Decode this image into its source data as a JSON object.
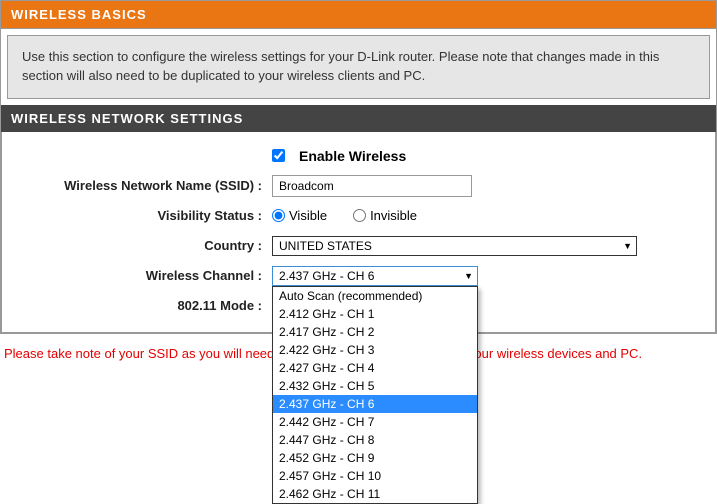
{
  "basics": {
    "title": "WIRELESS BASICS",
    "info": "Use this section to configure the wireless settings for your D-Link router. Please note that changes made in this section will also need to be duplicated to your wireless clients and PC."
  },
  "settings": {
    "title": "WIRELESS NETWORK SETTINGS",
    "enable_label": "Enable Wireless",
    "enable_checked": true,
    "ssid_label": "Wireless Network Name (SSID) :",
    "ssid_value": "Broadcom",
    "visibility_label": "Visibility Status :",
    "visibility_options": {
      "visible": "Visible",
      "invisible": "Invisible"
    },
    "visibility_selected": "visible",
    "country_label": "Country :",
    "country_value": "UNITED STATES",
    "channel_label": "Wireless Channel :",
    "channel_value": "2.437 GHz - CH 6",
    "channel_options": [
      "Auto Scan (recommended)",
      "2.412 GHz - CH 1",
      "2.417 GHz - CH 2",
      "2.422 GHz - CH 3",
      "2.427 GHz - CH 4",
      "2.432 GHz - CH 5",
      "2.437 GHz - CH 6",
      "2.442 GHz - CH 7",
      "2.447 GHz - CH 8",
      "2.452 GHz - CH 9",
      "2.457 GHz - CH 10",
      "2.462 GHz - CH 11"
    ],
    "mode_label": "802.11 Mode :",
    "mode_value": ""
  },
  "footer_note": "Please take note of your SSID as you will need to duplicate the same settings to your wireless devices and PC."
}
